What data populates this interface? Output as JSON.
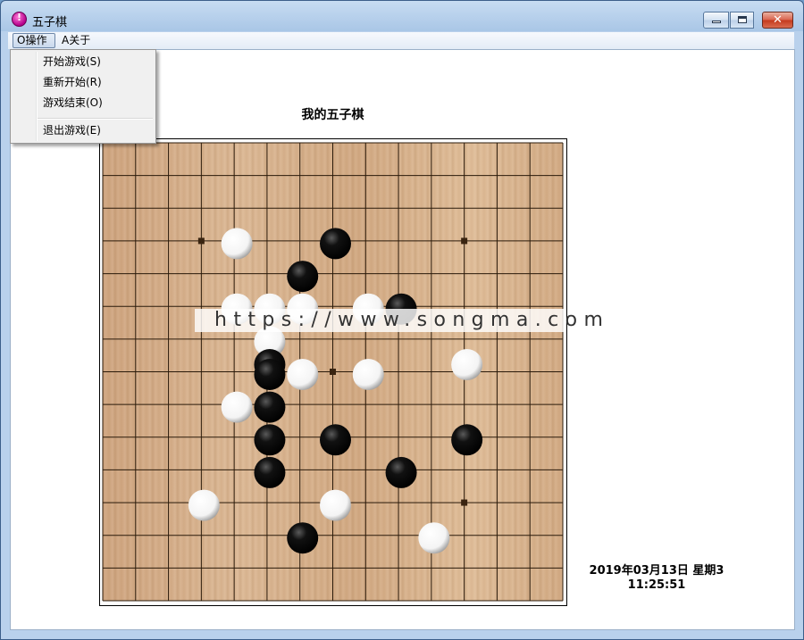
{
  "window": {
    "title": "五子棋"
  },
  "menubar": {
    "items": [
      "O操作",
      "A关于"
    ]
  },
  "dropdown": {
    "items": [
      "开始游戏(S)",
      "重新开始(R)",
      "游戏结束(O)",
      "退出游戏(E)"
    ]
  },
  "game": {
    "title": "我的五子棋",
    "board_size": 14,
    "star_points": [
      [
        3,
        3
      ],
      [
        11,
        3
      ],
      [
        7,
        7
      ],
      [
        11,
        11
      ]
    ],
    "stones": [
      {
        "col": 4,
        "row": 3,
        "color": "white"
      },
      {
        "col": 7,
        "row": 3,
        "color": "black"
      },
      {
        "col": 6,
        "row": 4,
        "color": "black"
      },
      {
        "col": 4,
        "row": 5,
        "color": "white"
      },
      {
        "col": 5,
        "row": 5,
        "color": "white"
      },
      {
        "col": 6,
        "row": 5,
        "color": "white"
      },
      {
        "col": 8,
        "row": 5,
        "color": "white"
      },
      {
        "col": 9,
        "row": 5,
        "color": "black"
      },
      {
        "col": 5,
        "row": 6,
        "color": "white"
      },
      {
        "col": 5,
        "row": 6.7,
        "color": "black"
      },
      {
        "col": 11,
        "row": 6.7,
        "color": "white"
      },
      {
        "col": 5,
        "row": 7,
        "color": "black"
      },
      {
        "col": 6,
        "row": 7,
        "color": "white"
      },
      {
        "col": 8,
        "row": 7,
        "color": "white"
      },
      {
        "col": 4,
        "row": 8,
        "color": "white"
      },
      {
        "col": 5,
        "row": 8,
        "color": "black"
      },
      {
        "col": 5,
        "row": 9,
        "color": "black"
      },
      {
        "col": 7,
        "row": 9,
        "color": "black"
      },
      {
        "col": 11,
        "row": 9,
        "color": "black"
      },
      {
        "col": 5,
        "row": 10,
        "color": "black"
      },
      {
        "col": 9,
        "row": 10,
        "color": "black"
      },
      {
        "col": 3,
        "row": 11,
        "color": "white"
      },
      {
        "col": 7,
        "row": 11,
        "color": "white"
      },
      {
        "col": 6,
        "row": 12,
        "color": "black"
      },
      {
        "col": 10,
        "row": 12,
        "color": "white"
      }
    ]
  },
  "status": {
    "date": "2019年03月13日 星期3",
    "time": "11:25:51"
  },
  "watermark": {
    "text": "https://www.songma.com"
  },
  "colors": {
    "grid_line": "#2a1a0a",
    "star": "#3a2410"
  }
}
